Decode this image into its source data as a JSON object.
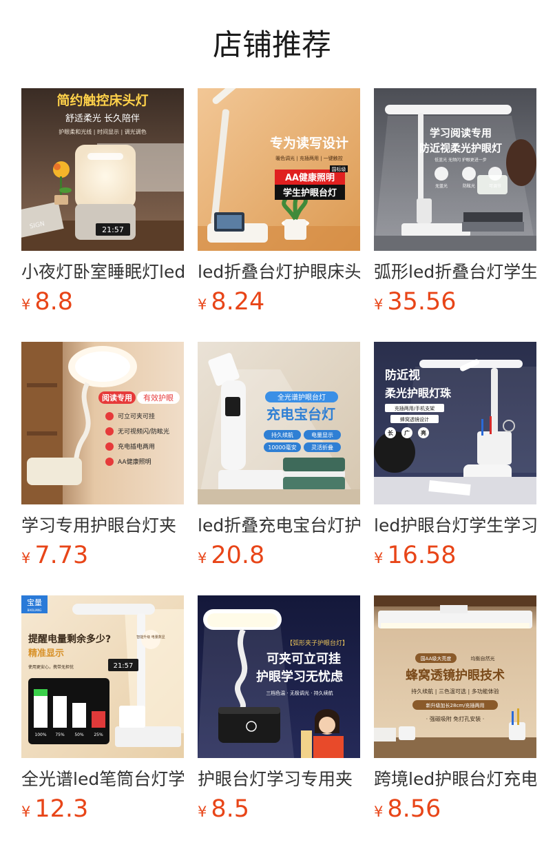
{
  "header": {
    "title": "店铺推荐"
  },
  "products": [
    {
      "name": "小夜灯卧室睡眠灯led",
      "currency": "¥",
      "price": "8.8",
      "overlay": [
        "简约触控床头灯",
        "舒适柔光 长久陪伴",
        "护眼柔和光线 | 时间显示 | 调光调色",
        "21:57",
        "SIGN"
      ]
    },
    {
      "name": "led折叠台灯护眼床头",
      "currency": "¥",
      "price": "8.24",
      "overlay": [
        "专为读写设计",
        "暖色调光 | 充插两用 | 一键触控",
        "AA健康照明",
        "学生护眼台灯",
        "国标级"
      ]
    },
    {
      "name": "弧形led折叠台灯学生",
      "currency": "¥",
      "price": "35.56",
      "overlay": [
        "学习阅读专用",
        "防近视柔光护眼灯",
        "低蓝光 无频闪 护眼更进一步",
        "无蓝光",
        "防眩光",
        "可调节"
      ]
    },
    {
      "name": "学习专用护眼台灯夹",
      "currency": "¥",
      "price": "7.73",
      "overlay": [
        "阅读专用",
        "有效护眼",
        "可立可夹可挂",
        "无可视频闪/防眩光",
        "充电插电两用",
        "AA健康照明"
      ]
    },
    {
      "name": "led折叠充电宝台灯护",
      "currency": "¥",
      "price": "20.8",
      "overlay": [
        "全光谱护眼台灯",
        "充电宝台灯",
        "持久续航",
        "电量显示",
        "10000毫安",
        "灵活折叠"
      ]
    },
    {
      "name": "led护眼台灯学生学习",
      "currency": "¥",
      "price": "16.58",
      "overlay": [
        "防近视",
        "柔光护眼灯珠",
        "充插两用/手机支架",
        "蜂窝透镜设计",
        "长",
        "广",
        "亮"
      ]
    },
    {
      "name": "全光谱led笔筒台灯学",
      "currency": "¥",
      "price": "12.3",
      "overlay": [
        "宝量",
        "BAOLIANG",
        "提醒电量剩余多少?",
        "精准显示",
        "使用更安心，携带无担忧",
        "21:57",
        "智能升级 电量数显",
        "100%",
        "75%",
        "50%",
        "25%"
      ]
    },
    {
      "name": "护眼台灯学习专用夹",
      "currency": "¥",
      "price": "8.5",
      "overlay": [
        "【弧形夹子护眼台灯】",
        "可夹可立可挂",
        "护眼学习无忧虑",
        "三档色温 · 无极调光 · 持久续航"
      ]
    },
    {
      "name": "跨境led护眼台灯充电",
      "currency": "¥",
      "price": "8.56",
      "overlay": [
        "国AA级大亮度",
        "均衡自然光",
        "蜂窝透镜护眼技术",
        "持久续航 | 三色温可选 | 多功能体验",
        "新升级加长28cm/充插两用",
        "· 强磁吸附  免打孔安装 ·"
      ]
    }
  ]
}
